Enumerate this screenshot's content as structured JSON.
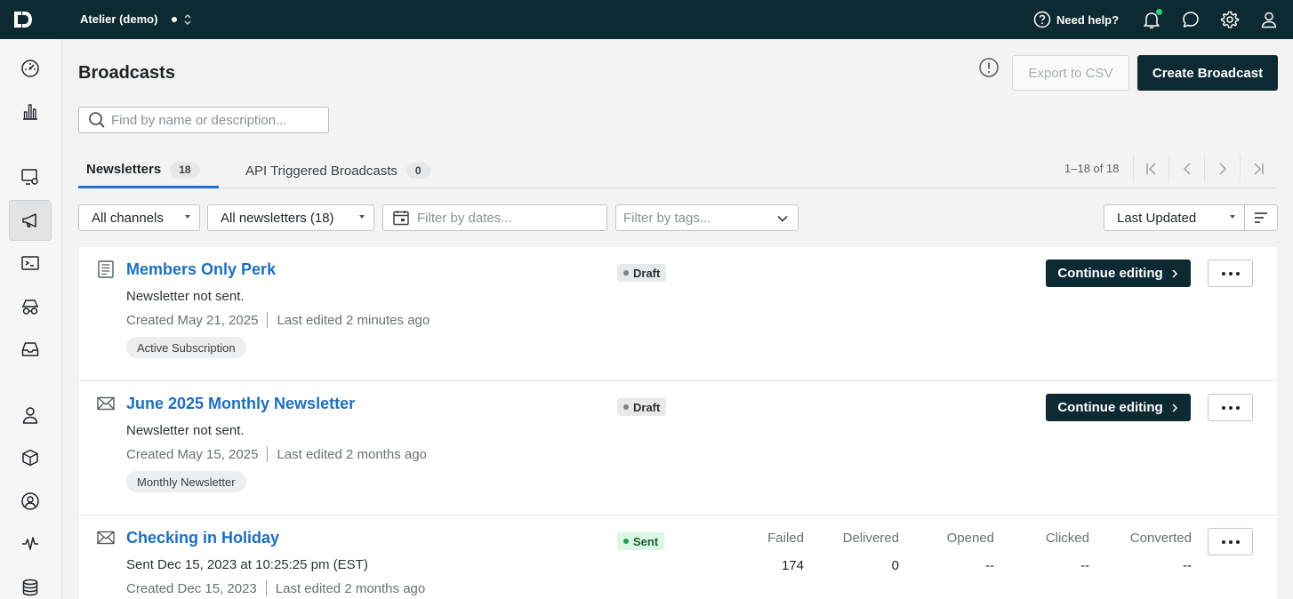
{
  "topbar": {
    "workspace": "Atelier (demo)",
    "help_label": "Need help?",
    "icons": [
      "help-circle-icon",
      "bell-icon",
      "chat-icon",
      "gear-icon",
      "user-icon"
    ],
    "notification_color": "#2fcf6a"
  },
  "sidebar": {
    "items": [
      {
        "name": "dashboard",
        "icon": "gauge-icon"
      },
      {
        "name": "analytics",
        "icon": "bar-chart-icon"
      },
      {
        "name": "campaigns",
        "icon": "monitor-gear-icon"
      },
      {
        "name": "broadcasts",
        "icon": "megaphone-icon",
        "active": true
      },
      {
        "name": "transactional",
        "icon": "terminal-icon"
      },
      {
        "name": "segments",
        "icon": "glasses-icon"
      },
      {
        "name": "inbox",
        "icon": "inbox-icon"
      },
      {
        "name": "people",
        "icon": "person-icon"
      },
      {
        "name": "objects",
        "icon": "cube-icon"
      },
      {
        "name": "accounts",
        "icon": "person-circle-icon"
      },
      {
        "name": "activity",
        "icon": "pulse-icon"
      },
      {
        "name": "data",
        "icon": "database-icon"
      }
    ]
  },
  "page": {
    "title": "Broadcasts",
    "export_label": "Export to CSV",
    "create_label": "Create Broadcast",
    "search_placeholder": "Find by name or description..."
  },
  "tabs": [
    {
      "label": "Newsletters",
      "count": "18",
      "active": true
    },
    {
      "label": "API Triggered Broadcasts",
      "count": "0",
      "active": false
    }
  ],
  "pager": {
    "text": "1–18 of 18"
  },
  "filters": {
    "channels": "All channels",
    "newsletters": "All newsletters (18)",
    "dates_placeholder": "Filter by dates...",
    "tags_placeholder": "Filter by tags...",
    "sort": "Last Updated"
  },
  "broadcasts": [
    {
      "icon": "document-icon",
      "title": "Members Only Perk",
      "subtitle": "Newsletter not sent.",
      "created": "Created May 21, 2025",
      "edited": "Last edited 2 minutes ago",
      "tag": "Active Subscription",
      "status": "Draft",
      "action": "Continue editing"
    },
    {
      "icon": "envelope-icon",
      "title": "June 2025 Monthly Newsletter",
      "subtitle": "Newsletter not sent.",
      "created": "Created May 15, 2025",
      "edited": "Last edited 2 months ago",
      "tag": "Monthly Newsletter",
      "status": "Draft",
      "action": "Continue editing"
    },
    {
      "icon": "envelope-icon",
      "title": "Checking in Holiday",
      "subtitle": "Sent Dec 15, 2023 at 10:25:25 pm (EST)",
      "created": "Created Dec 15, 2023",
      "edited": "Last edited 2 months ago",
      "status": "Sent",
      "metrics": [
        {
          "label": "Failed",
          "value": "174"
        },
        {
          "label": "Delivered",
          "value": "0"
        },
        {
          "label": "Opened",
          "value": "--"
        },
        {
          "label": "Clicked",
          "value": "--"
        },
        {
          "label": "Converted",
          "value": "--"
        }
      ]
    }
  ],
  "colors": {
    "brand_dark": "#0d2a33",
    "link_blue": "#1a6fc9",
    "sent_green": "#1f9f4f"
  }
}
